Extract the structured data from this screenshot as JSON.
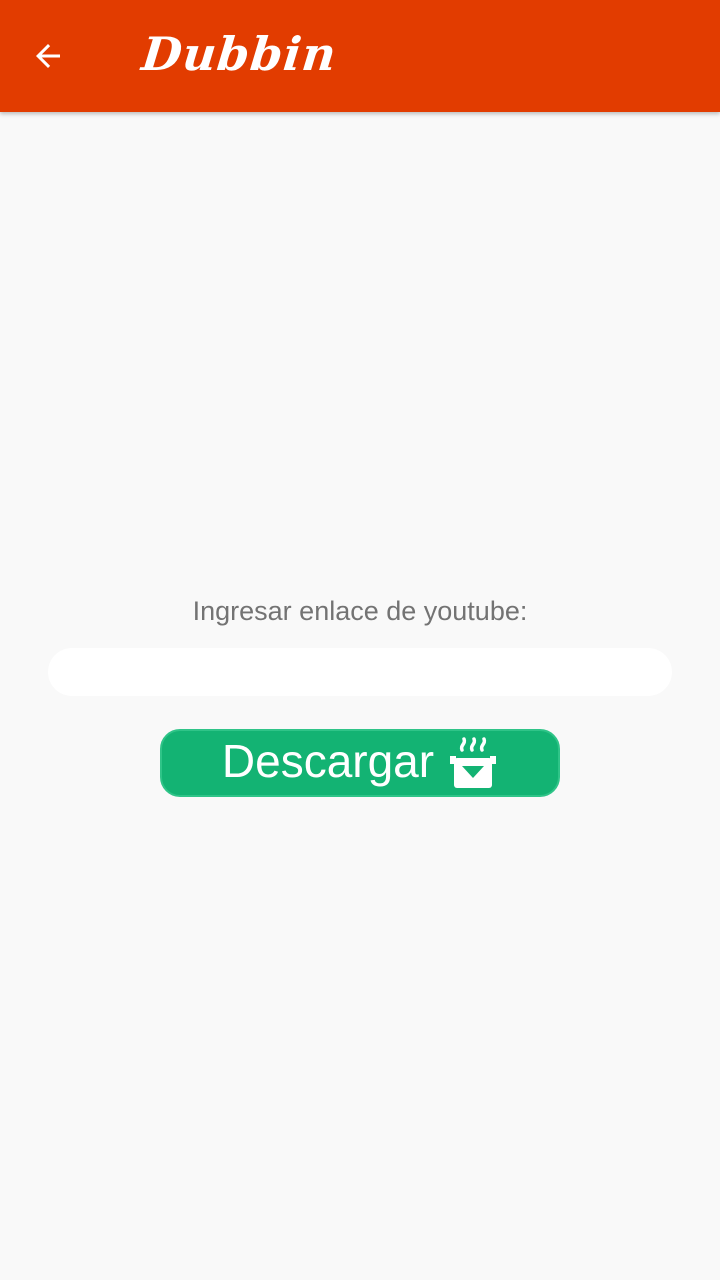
{
  "appbar": {
    "back_icon": "arrow-left-icon",
    "logo_text": "Dubbin",
    "background": "#e23c00"
  },
  "form": {
    "prompt": "Ingresar enlace de youtube:",
    "url_value": "",
    "url_placeholder": ""
  },
  "download_button": {
    "label": "Descargar",
    "icon": "download-box-icon",
    "color": "#13b373"
  }
}
